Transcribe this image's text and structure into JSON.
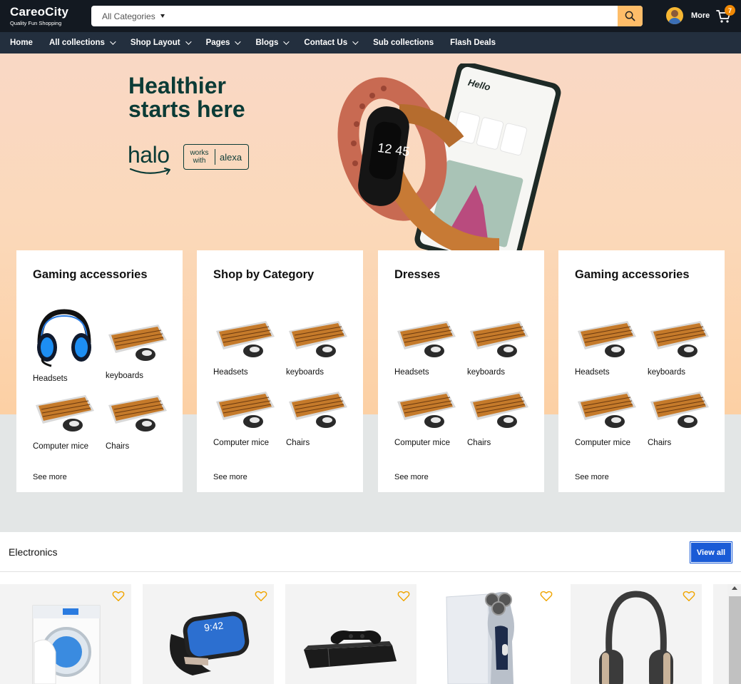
{
  "header": {
    "brand": "CareoCity",
    "tagline": "Quality Fun Shopping",
    "search_category": "All Categories",
    "search_placeholder": "",
    "more_label": "More",
    "cart_count": "7"
  },
  "nav": {
    "items": [
      {
        "label": "Home",
        "dropdown": false
      },
      {
        "label": "All collections",
        "dropdown": true
      },
      {
        "label": "Shop Layout",
        "dropdown": true
      },
      {
        "label": "Pages",
        "dropdown": true
      },
      {
        "label": "Blogs",
        "dropdown": true
      },
      {
        "label": "Contact Us",
        "dropdown": true
      },
      {
        "label": "Sub collections",
        "dropdown": false
      },
      {
        "label": "Flash Deals",
        "dropdown": false
      }
    ]
  },
  "hero": {
    "headline": "Healthier starts here",
    "logo_text": "halo",
    "badge_works": "works with",
    "badge_alexa": "alexa",
    "watch_time": "12 45",
    "phone_greeting": "Hello"
  },
  "cards": [
    {
      "title": "Gaming accessories",
      "tiles": [
        "Headsets",
        "keyboards",
        "Computer mice",
        "Chairs"
      ],
      "see_more": "See more"
    },
    {
      "title": "Shop by Category",
      "tiles": [
        "Headsets",
        "keyboards",
        "Computer mice",
        "Chairs"
      ],
      "see_more": "See more"
    },
    {
      "title": "Dresses",
      "tiles": [
        "Headsets",
        "keyboards",
        "Computer mice",
        "Chairs"
      ],
      "see_more": "See more"
    },
    {
      "title": "Gaming accessories",
      "tiles": [
        "Headsets",
        "keyboards",
        "Computer mice",
        "Chairs"
      ],
      "see_more": "See more"
    }
  ],
  "electronics": {
    "title": "Electronics",
    "view_all": "View all",
    "products": [
      "washing-machine",
      "smartwatch",
      "game-console",
      "electric-shaver",
      "headphones"
    ]
  },
  "colors": {
    "header_bg": "#131921",
    "nav_bg": "#232f3e",
    "search_button": "#febd69",
    "badge": "#f08804",
    "view_all": "#1a5bd6",
    "heart": "#f0a500"
  }
}
